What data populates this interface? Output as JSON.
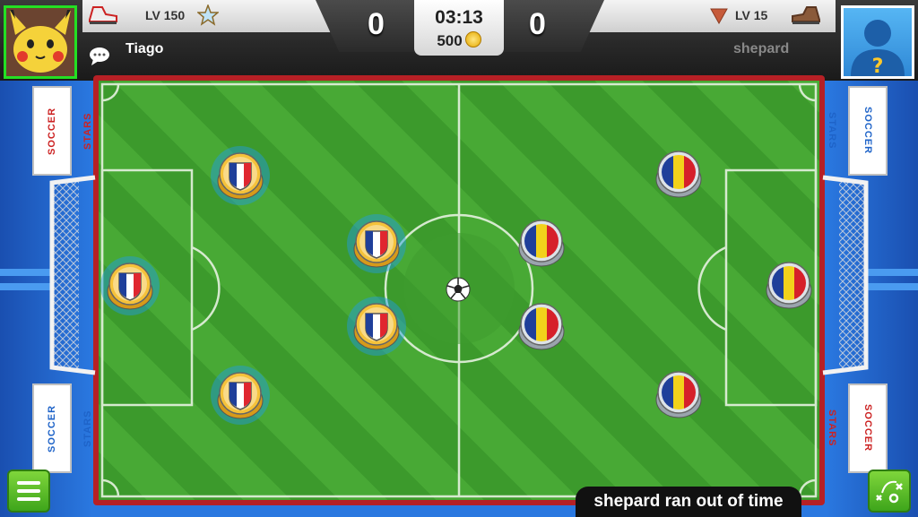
{
  "header": {
    "left_player": {
      "level": "LV 150",
      "name": "Tiago",
      "score": "0"
    },
    "right_player": {
      "level": "LV 15",
      "name": "shepard",
      "score": "0"
    },
    "timer": "03:13",
    "coins": "500"
  },
  "notification": "shepard  ran out of time",
  "ad_board_text": "SOCCER STARS",
  "teams": {
    "left": {
      "flag": "france",
      "colors": [
        "#1f3f9a",
        "#ffffff",
        "#e0262f"
      ]
    },
    "right": {
      "flag": "romania",
      "colors": [
        "#1f3f9a",
        "#f2d21b",
        "#d6202a"
      ]
    }
  },
  "colors": {
    "accent_green": "#3ea51b",
    "pitch_dark": "#3c9a2c",
    "pitch_light": "#48a935",
    "frame_red": "#b62025"
  },
  "icons": [
    "player-avatar",
    "unknown-avatar",
    "star-icon",
    "rank-down-icon",
    "boot-icon",
    "chat-icon",
    "coin-icon",
    "menu-icon",
    "tactics-icon"
  ]
}
